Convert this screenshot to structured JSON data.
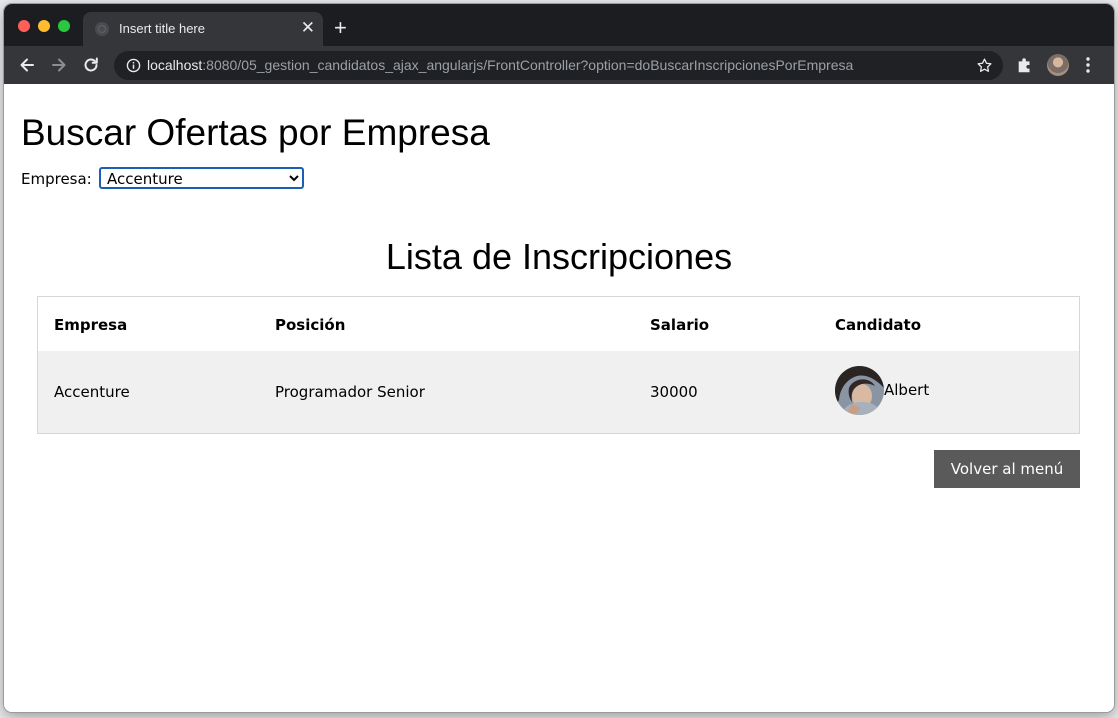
{
  "browser": {
    "tab_title": "Insert title here",
    "tab_close": "✕",
    "new_tab": "+",
    "url_host": "localhost",
    "url_rest": ":8080/05_gestion_candidatos_ajax_angularjs/FrontController?option=doBuscarInscripcionesPorEmpresa"
  },
  "page": {
    "title": "Buscar Ofertas por Empresa",
    "filter_label": "Empresa:",
    "selected_empresa": "Accenture",
    "list_title": "Lista de Inscripciones",
    "back_button": "Volver al menú"
  },
  "table": {
    "headers": [
      "Empresa",
      "Posición",
      "Salario",
      "Candidato"
    ],
    "rows": [
      {
        "empresa": "Accenture",
        "posicion": "Programador Senior",
        "salario": "30000",
        "candidato": "Albert"
      }
    ]
  }
}
